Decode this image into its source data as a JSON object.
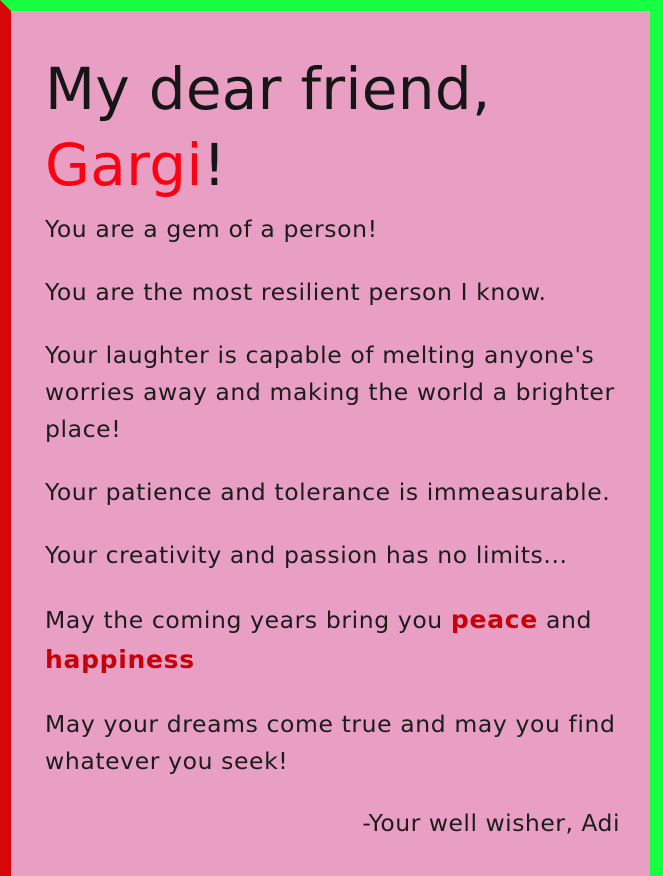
{
  "card": {
    "greeting": "My dear friend,",
    "name": "Gargi",
    "exclamation": "!",
    "lines": [
      "You are a gem of a person!",
      "You are the most resilient person I know.",
      "Your laughter is capable of melting anyone's worries away and making the world a brighter place!",
      "Your patience and tolerance is immeasurable.",
      "Your creativity and passion has no limits..."
    ],
    "wish": {
      "prefix": "May the coming years bring you ",
      "highlight_1": "peace",
      "middle": " and ",
      "highlight_2": "happiness"
    },
    "dreams": "May your dreams come true and may you find whatever you seek!",
    "signature": "-Your well wisher, Adi"
  },
  "colors": {
    "background": "#e99fc3",
    "border_top_right": "#16ff40",
    "border_left": "#d80707",
    "name": "#ff0011",
    "highlight": "#c8000a",
    "text": "#1c1c1c"
  }
}
